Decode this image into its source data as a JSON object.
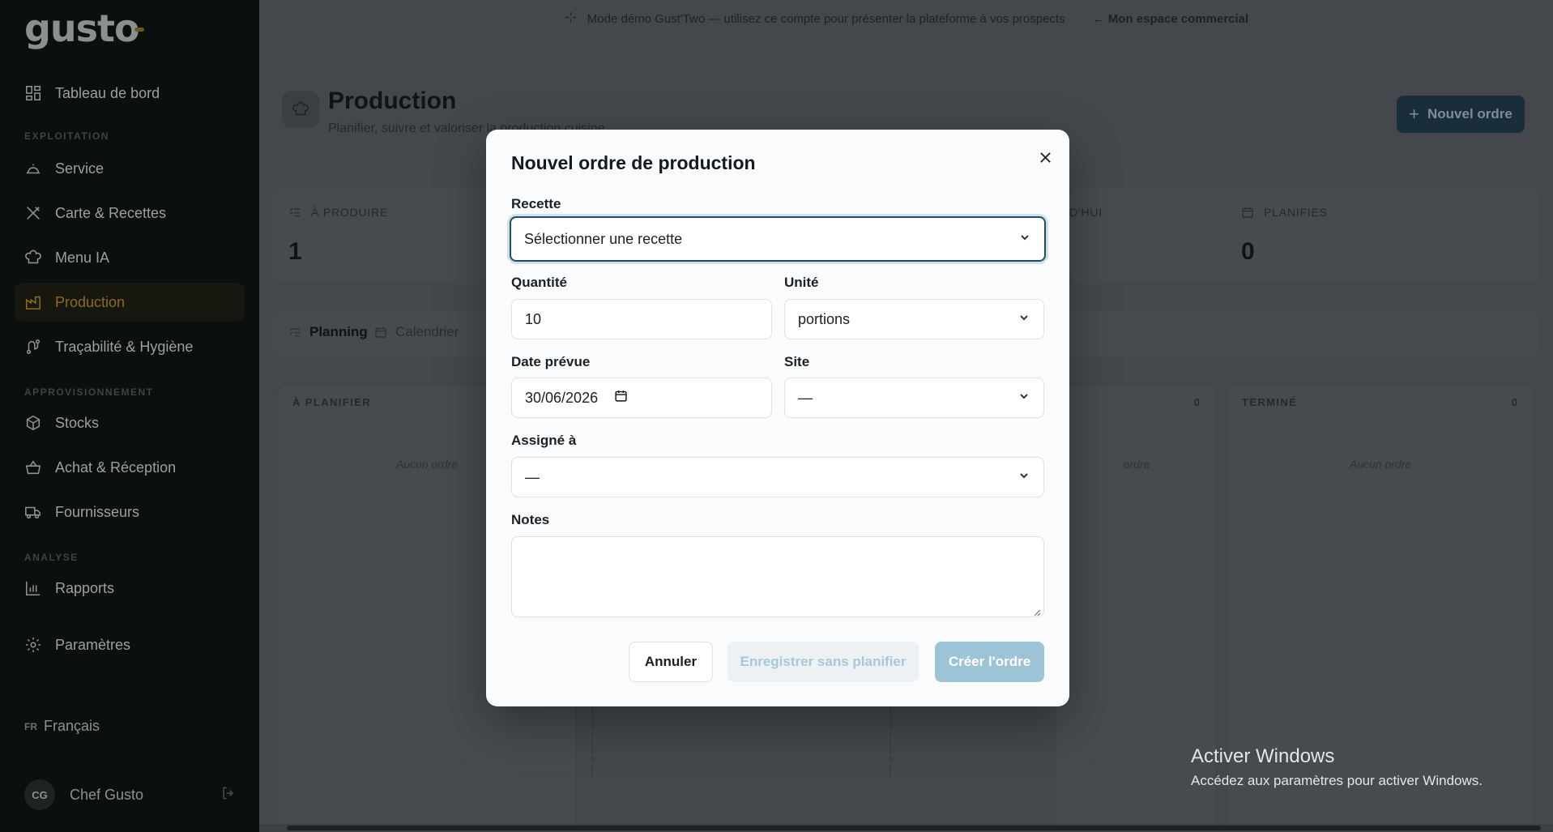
{
  "app": {
    "logo": "gusto",
    "banner_text": "Mode démo Gust'Two — utilisez ce compte pour présenter la plateforme à vos prospects",
    "banner_link": "← Mon espace commercial"
  },
  "sidebar": {
    "dashboard": "Tableau de bord",
    "section_operations": "EXPLOITATION",
    "service": "Service",
    "menu_recipes": "Carte & Recettes",
    "menu_ai": "Menu IA",
    "production": "Production",
    "traceability": "Traçabilité & Hygiène",
    "section_supply": "APPROVISIONNEMENT",
    "stocks": "Stocks",
    "purchase": "Achat & Réception",
    "suppliers": "Fournisseurs",
    "section_analysis": "ANALYSE",
    "reports": "Rapports",
    "settings": "Paramètres",
    "lang_code": "FR",
    "lang_label": "Français",
    "user_initials": "CG",
    "user_name": "Chef Gusto"
  },
  "page": {
    "title": "Production",
    "subtitle": "Planifier, suivre et valoriser la production cuisine",
    "new_order": "Nouvel ordre",
    "stats": [
      {
        "label": "À PRODUIRE",
        "value": "1"
      },
      {
        "label": "D'HUI",
        "value": ""
      },
      {
        "label": "PLANIFIÉS",
        "value": "0"
      }
    ],
    "tabs": [
      "Planning",
      "Calendrier"
    ],
    "columns": [
      {
        "title": "À PLANIFIER",
        "count": "",
        "empty": "Aucun ordre"
      },
      {
        "title": "",
        "count": "0",
        "empty": "ordre"
      },
      {
        "title": "TERMINÉ",
        "count": "0",
        "empty": "Aucun ordre"
      }
    ]
  },
  "modal": {
    "title": "Nouvel ordre de production",
    "recipe_label": "Recette",
    "recipe_value": "Sélectionner une recette",
    "quantity_label": "Quantité",
    "quantity_value": "10",
    "unit_label": "Unité",
    "unit_value": "portions",
    "date_label": "Date prévue",
    "date_value": "30/06/2026",
    "site_label": "Site",
    "site_value": "—",
    "assigned_label": "Assigné à",
    "assigned_value": "—",
    "notes_label": "Notes",
    "notes_value": "",
    "cancel": "Annuler",
    "save_unplanned": "Enregistrer sans planifier",
    "create": "Créer l'ordre"
  },
  "watermark": {
    "line1": "Activer Windows",
    "line2": "Accédez aux paramètres pour activer Windows."
  },
  "colors": {
    "accent": "#1f4f66",
    "primary_disabled": "#9cc4d6",
    "sidebar_bg": "#0b0f0d",
    "active_nav": "#8a6d1a"
  }
}
